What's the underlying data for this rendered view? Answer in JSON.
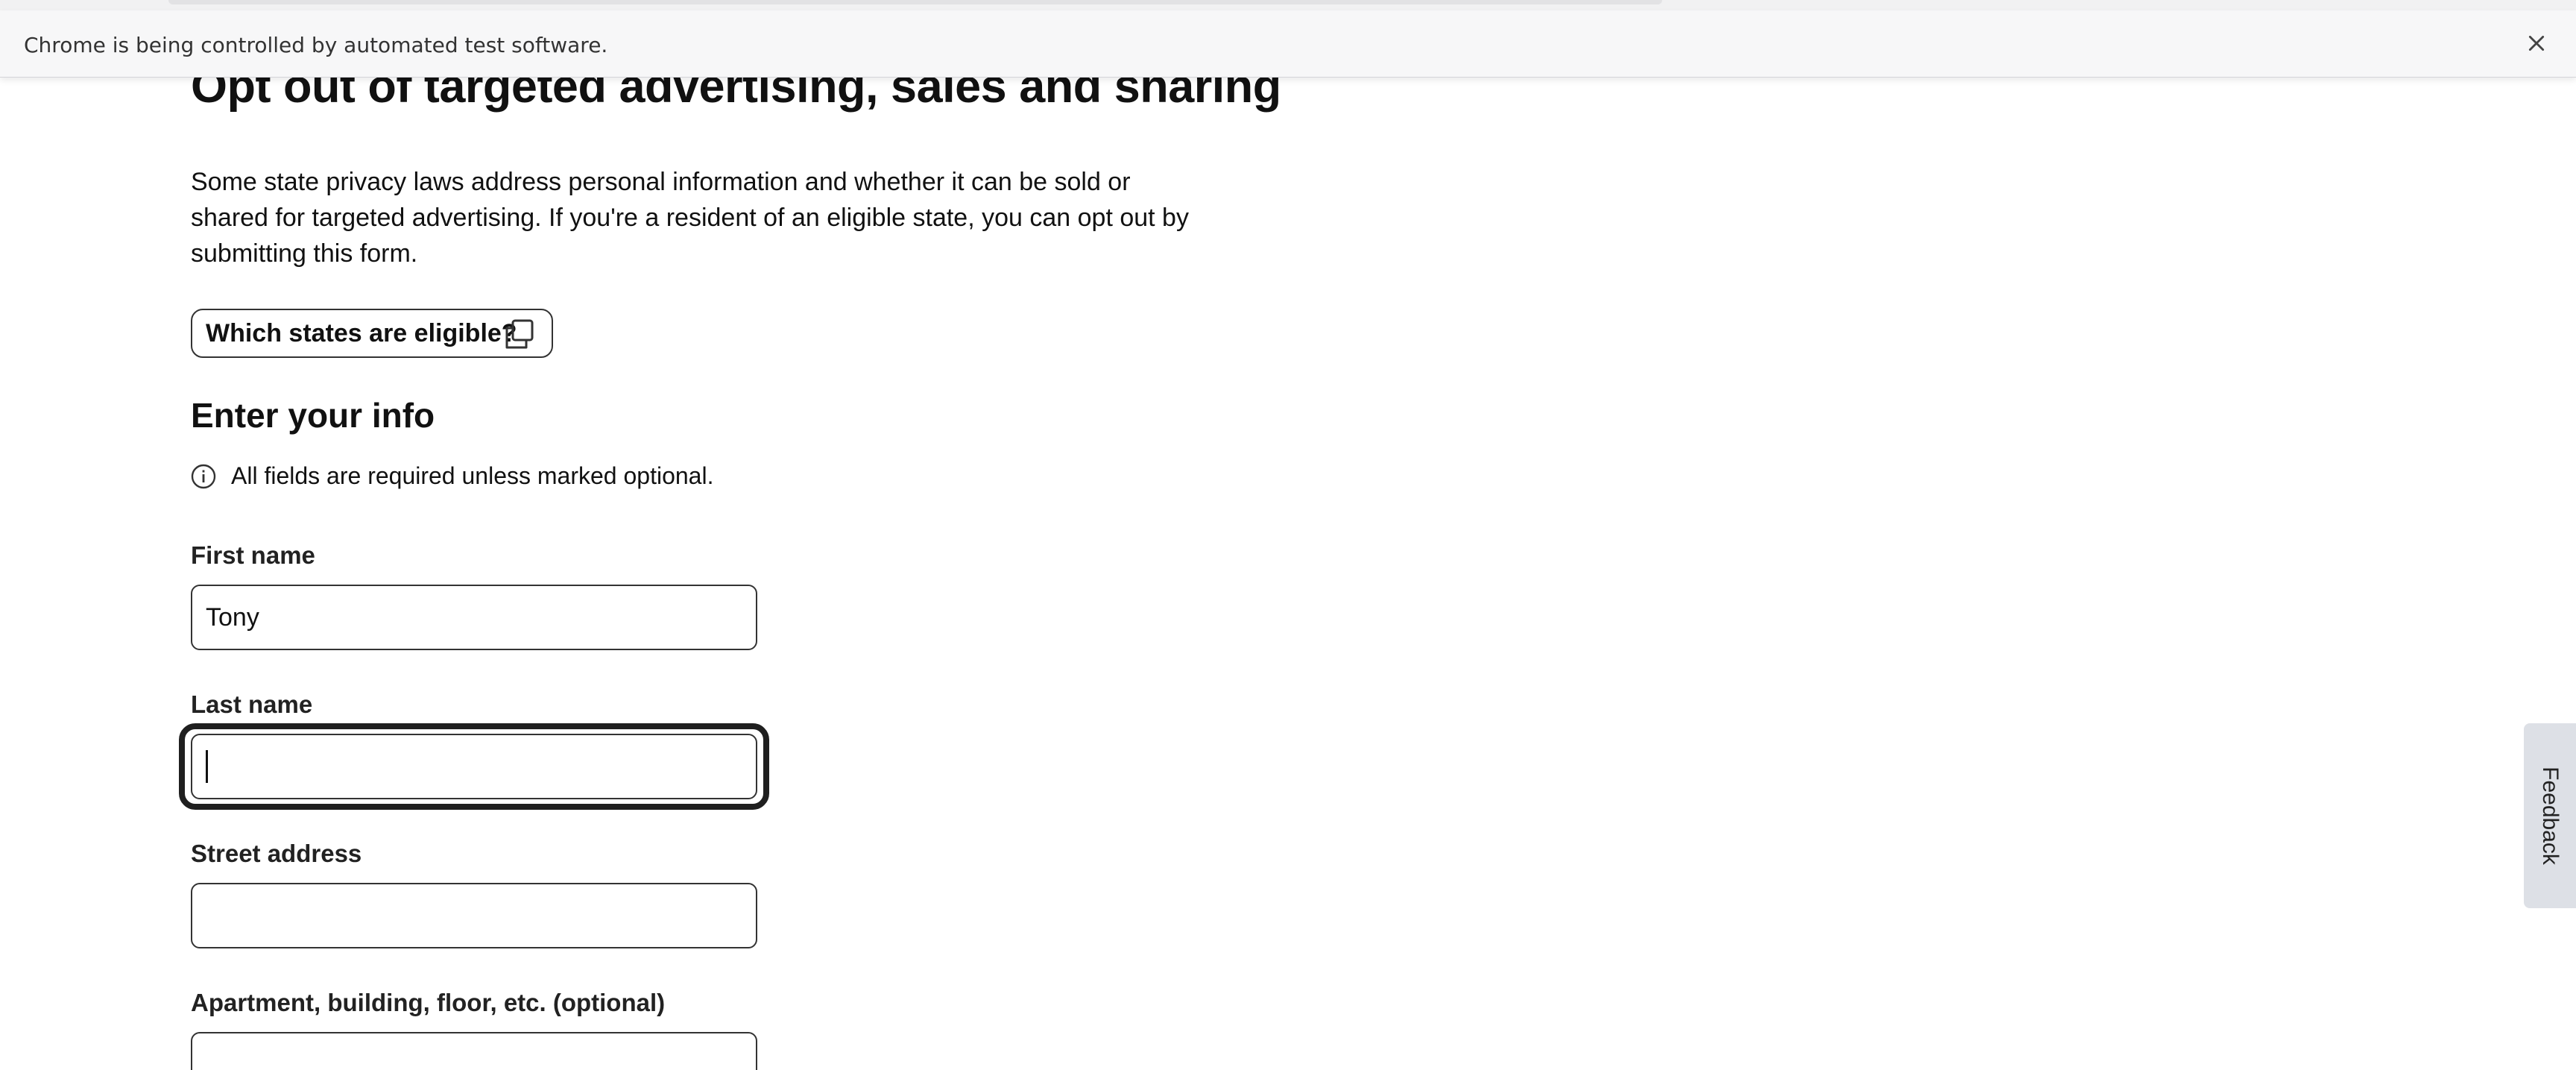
{
  "automation_bar": {
    "message": "Chrome is being controlled by automated test software."
  },
  "page": {
    "title": "Opt out of targeted advertising, sales and sharing",
    "intro": "Some state privacy laws address personal information and whether it can be sold or shared for targeted advertising. If you're a resident of an eligible state, you can opt out by submitting this form.",
    "states_button_label": "Which states are eligible?",
    "section_heading": "Enter your info",
    "required_notice": "All fields are required unless marked optional."
  },
  "form": {
    "first_name": {
      "label": "First name",
      "value": "Tony"
    },
    "last_name": {
      "label": "Last name",
      "value": ""
    },
    "street_address": {
      "label": "Street address",
      "value": ""
    },
    "apartment": {
      "label": "Apartment, building, floor, etc. (optional)",
      "value": ""
    }
  },
  "feedback": {
    "label": "Feedback"
  },
  "icons": {
    "close": "close-icon",
    "copy": "copy-icon",
    "info": "info-icon"
  }
}
